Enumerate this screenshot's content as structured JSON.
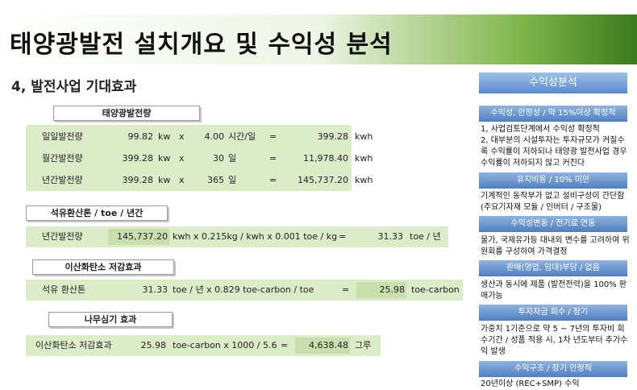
{
  "title": "태양광발전 설치개요 및 수익성 분석",
  "subtitle": "4, 발전사업 기대효과",
  "sections": {
    "solar": {
      "label": "태양광발전량",
      "rows": [
        {
          "name": "일일발전량",
          "value": "99.82",
          "unit": "kw",
          "op": "x",
          "mult": "4.00",
          "mult_unit": "시간/일",
          "eq": "=",
          "result": "399.28",
          "result_unit": "kwh"
        },
        {
          "name": "월간발전량",
          "value": "399.28",
          "unit": "kw",
          "op": "x",
          "mult": "30",
          "mult_unit": "일",
          "eq": "=",
          "result": "11,978.40",
          "result_unit": "kwh"
        },
        {
          "name": "년간발전량",
          "value": "399.28",
          "unit": "kw",
          "op": "x",
          "mult": "365",
          "mult_unit": "일",
          "eq": "=",
          "result": "145,737.20",
          "result_unit": "kwh"
        }
      ]
    },
    "oil": {
      "label": "석유환산톤 / toe / 년간",
      "name": "년간발전량",
      "value": "145,737.20",
      "formula": "kwh x 0.215kg / kwh x 0.001 toe / kg",
      "eq": "=",
      "result": "31.33",
      "result_unit": "toe / 년"
    },
    "co2": {
      "label": "이산화탄소 저감효과",
      "name": "석유 환산톤",
      "value": "31.33",
      "formula": "toe / 년 x 0.829  toe-carbon / toe",
      "eq": "=",
      "result": "25.98",
      "result_unit": "toe-carbon"
    },
    "tree": {
      "label": "나무심기 효과",
      "name": "이산화탄소 저감효과",
      "value": "25.98",
      "formula": "toe-carbon x 1000 / 5.6",
      "eq": "=",
      "result": "4,638.48",
      "result_unit": "그루"
    }
  },
  "sidebar": {
    "title": "수익성분석",
    "blocks": [
      {
        "header": "수익성, 안정성 / 약 15%이상 확정적",
        "text": "1, 사업검토단계에서 수익성 확정적\n2, 대부분의 시설투자는 투자규모가 커질수록 수익률이 저하되나 태양광 발전사업 경우 수익률이 저하되지 않고 커진다"
      },
      {
        "header": "유지비용 / 10% 미만",
        "text": "기계적인 동작부가 없고 설비구성이 간단함 (주요기자재 모듈 / 인버터 / 구조물)"
      },
      {
        "header": "수익성변동 / 전기료 연동",
        "text": "물가, 국제유가등 대내외 변수를 고려하여 위원회를 구성하여 가격결정"
      },
      {
        "header": "판매(영업, 임대)부담 / 없음",
        "text": "생산과 동시에 제품 (발전전력)을 100% 판매가능"
      },
      {
        "header": "투자자금 회수 / 장기",
        "text": "가중치 1기준으로 약 5 ~ 7년의 투자비 회수기간 / 성품 적용 시, 1차 년도부터 추가수익 발생"
      },
      {
        "header": "수익구조 / 장기 안정적",
        "text": "20년이상 (REC+SMP) 수익"
      }
    ]
  }
}
